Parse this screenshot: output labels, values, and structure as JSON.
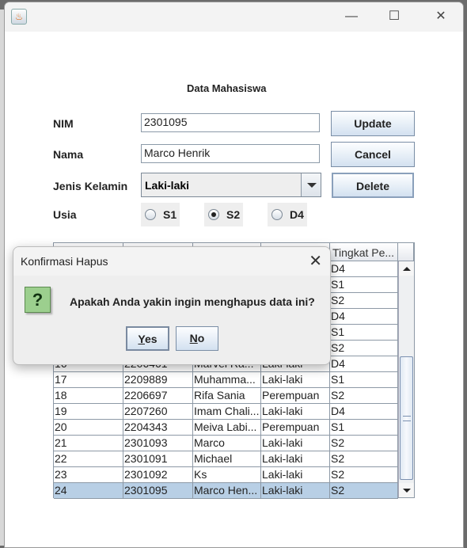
{
  "window": {
    "title": "",
    "minimize": "—",
    "maximize": "☐",
    "close": "✕"
  },
  "form": {
    "heading": "Data Mahasiswa",
    "nim_label": "NIM",
    "nim_value": "2301095",
    "nama_label": "Nama",
    "nama_value": "Marco Henrik",
    "jk_label": "Jenis Kelamin",
    "jk_value": "Laki-laki",
    "usia_label": "Usia",
    "radios": [
      {
        "label": "S1",
        "checked": false
      },
      {
        "label": "S2",
        "checked": true
      },
      {
        "label": "D4",
        "checked": false
      }
    ],
    "buttons": {
      "update": "Update",
      "cancel": "Cancel",
      "delete": "Delete"
    }
  },
  "table": {
    "headers": [
      "",
      "",
      "",
      "",
      "Tingkat Pe..."
    ],
    "rows": [
      [
        "",
        "",
        "",
        "",
        "D4"
      ],
      [
        "",
        "",
        "",
        "",
        "S1"
      ],
      [
        "",
        "",
        "",
        "",
        "S2"
      ],
      [
        "",
        "",
        "",
        "",
        "D4"
      ],
      [
        "",
        "",
        "",
        "",
        "S1"
      ],
      [
        "",
        "",
        "",
        "",
        "S2"
      ],
      [
        "16",
        "2206461",
        "Marvel Ra...",
        "Laki-laki",
        "D4"
      ],
      [
        "17",
        "2209889",
        "Muhamma...",
        "Laki-laki",
        "S1"
      ],
      [
        "18",
        "2206697",
        "Rifa Sania",
        "Perempuan",
        "S2"
      ],
      [
        "19",
        "2207260",
        "Imam Chali...",
        "Laki-laki",
        "D4"
      ],
      [
        "20",
        "2204343",
        "Meiva Labi...",
        "Perempuan",
        "S1"
      ],
      [
        "21",
        "2301093",
        "Marco",
        "Laki-laki",
        "S2"
      ],
      [
        "22",
        "2301091",
        "Michael",
        "Laki-laki",
        "S2"
      ],
      [
        "23",
        "2301092",
        "Ks",
        "Laki-laki",
        "S2"
      ],
      [
        "24",
        "2301095",
        "Marco Hen...",
        "Laki-laki",
        "S2"
      ]
    ],
    "selected_row_index": 14
  },
  "dialog": {
    "title": "Konfirmasi Hapus",
    "close": "✕",
    "icon": "question-icon",
    "icon_glyph": "?",
    "message": "Apakah Anda yakin ingin menghapus data ini?",
    "yes": "Yes",
    "no": "No"
  }
}
